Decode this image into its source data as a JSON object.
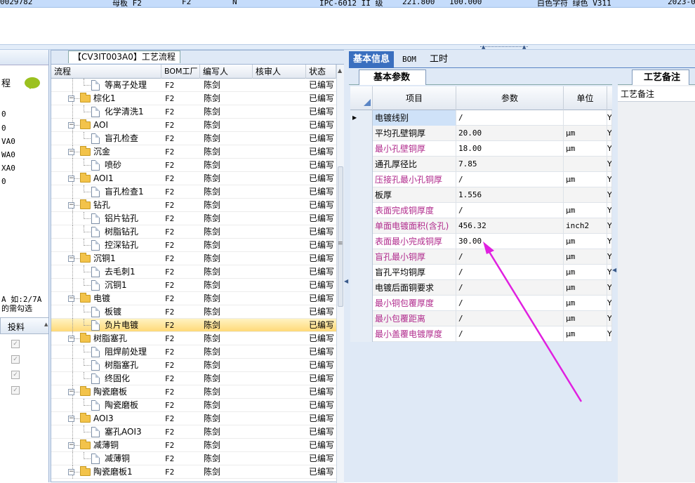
{
  "top_strip": {
    "cells": [
      "0029782",
      "母板 F2",
      "F2",
      "N",
      "IPC-6012 II 级",
      "221.800",
      "100.000",
      "白色字符 绿色 V311",
      "2023-0"
    ]
  },
  "left_panel": {
    "header": "程",
    "rows": [
      "0",
      "0",
      "VA0",
      "WA0",
      "XA0",
      "0"
    ],
    "note_line1": "A 如:2/7A",
    "note_line2": "的需勾选",
    "column_header": "投料",
    "checkboxes": [
      true,
      true,
      true,
      true
    ]
  },
  "process_panel": {
    "title": "【CV3IT003A0】工艺流程",
    "columns": [
      "流程",
      "BOM工厂",
      "编写人",
      "核审人",
      "状态"
    ],
    "rows": [
      {
        "level": 2,
        "type": "doc",
        "name": "等离子处理",
        "bom": "F2",
        "writer": "陈剑",
        "reviewer": "",
        "status": "已编写"
      },
      {
        "level": 1,
        "type": "folder",
        "name": "棕化1",
        "bom": "F2",
        "writer": "陈剑",
        "reviewer": "",
        "status": "已编写"
      },
      {
        "level": 2,
        "type": "doc",
        "name": "化学清洗1",
        "bom": "F2",
        "writer": "陈剑",
        "reviewer": "",
        "status": "已编写"
      },
      {
        "level": 1,
        "type": "folder",
        "name": "AOI",
        "bom": "F2",
        "writer": "陈剑",
        "reviewer": "",
        "status": "已编写"
      },
      {
        "level": 2,
        "type": "doc",
        "name": "盲孔检查",
        "bom": "F2",
        "writer": "陈剑",
        "reviewer": "",
        "status": "已编写"
      },
      {
        "level": 1,
        "type": "folder",
        "name": "沉金",
        "bom": "F2",
        "writer": "陈剑",
        "reviewer": "",
        "status": "已编写"
      },
      {
        "level": 2,
        "type": "doc",
        "name": "喷砂",
        "bom": "F2",
        "writer": "陈剑",
        "reviewer": "",
        "status": "已编写"
      },
      {
        "level": 1,
        "type": "folder",
        "name": "AOI1",
        "bom": "F2",
        "writer": "陈剑",
        "reviewer": "",
        "status": "已编写"
      },
      {
        "level": 2,
        "type": "doc",
        "name": "盲孔检查1",
        "bom": "F2",
        "writer": "陈剑",
        "reviewer": "",
        "status": "已编写"
      },
      {
        "level": 1,
        "type": "folder",
        "name": "钻孔",
        "bom": "F2",
        "writer": "陈剑",
        "reviewer": "",
        "status": "已编写"
      },
      {
        "level": 2,
        "type": "doc",
        "name": "铝片钻孔",
        "bom": "F2",
        "writer": "陈剑",
        "reviewer": "",
        "status": "已编写"
      },
      {
        "level": 2,
        "type": "doc",
        "name": "树脂钻孔",
        "bom": "F2",
        "writer": "陈剑",
        "reviewer": "",
        "status": "已编写"
      },
      {
        "level": 2,
        "type": "doc",
        "name": "控深钻孔",
        "bom": "F2",
        "writer": "陈剑",
        "reviewer": "",
        "status": "已编写"
      },
      {
        "level": 1,
        "type": "folder",
        "name": "沉铜1",
        "bom": "F2",
        "writer": "陈剑",
        "reviewer": "",
        "status": "已编写"
      },
      {
        "level": 2,
        "type": "doc",
        "name": "去毛刺1",
        "bom": "F2",
        "writer": "陈剑",
        "reviewer": "",
        "status": "已编写"
      },
      {
        "level": 2,
        "type": "doc",
        "name": "沉铜1",
        "bom": "F2",
        "writer": "陈剑",
        "reviewer": "",
        "status": "已编写"
      },
      {
        "level": 1,
        "type": "folder",
        "name": "电镀",
        "bom": "F2",
        "writer": "陈剑",
        "reviewer": "",
        "status": "已编写"
      },
      {
        "level": 2,
        "type": "doc",
        "name": "板镀",
        "bom": "F2",
        "writer": "陈剑",
        "reviewer": "",
        "status": "已编写"
      },
      {
        "level": 2,
        "type": "doc",
        "name": "负片电镀",
        "bom": "F2",
        "writer": "陈剑",
        "reviewer": "",
        "status": "已编写",
        "selected": true
      },
      {
        "level": 1,
        "type": "folder",
        "name": "树脂塞孔",
        "bom": "F2",
        "writer": "陈剑",
        "reviewer": "",
        "status": "已编写"
      },
      {
        "level": 2,
        "type": "doc",
        "name": "阻焊前处理",
        "bom": "F2",
        "writer": "陈剑",
        "reviewer": "",
        "status": "已编写"
      },
      {
        "level": 2,
        "type": "doc",
        "name": "树脂塞孔",
        "bom": "F2",
        "writer": "陈剑",
        "reviewer": "",
        "status": "已编写"
      },
      {
        "level": 2,
        "type": "doc",
        "name": "终固化",
        "bom": "F2",
        "writer": "陈剑",
        "reviewer": "",
        "status": "已编写"
      },
      {
        "level": 1,
        "type": "folder",
        "name": "陶瓷磨板",
        "bom": "F2",
        "writer": "陈剑",
        "reviewer": "",
        "status": "已编写"
      },
      {
        "level": 2,
        "type": "doc",
        "name": "陶瓷磨板",
        "bom": "F2",
        "writer": "陈剑",
        "reviewer": "",
        "status": "已编写"
      },
      {
        "level": 1,
        "type": "folder",
        "name": "AOI3",
        "bom": "F2",
        "writer": "陈剑",
        "reviewer": "",
        "status": "已编写"
      },
      {
        "level": 2,
        "type": "doc",
        "name": "塞孔AOI3",
        "bom": "F2",
        "writer": "陈剑",
        "reviewer": "",
        "status": "已编写"
      },
      {
        "level": 1,
        "type": "folder",
        "name": "减薄铜",
        "bom": "F2",
        "writer": "陈剑",
        "reviewer": "",
        "status": "已编写"
      },
      {
        "level": 2,
        "type": "doc",
        "name": "减薄铜",
        "bom": "F2",
        "writer": "陈剑",
        "reviewer": "",
        "status": "已编写"
      },
      {
        "level": 1,
        "type": "folder",
        "name": "陶瓷磨板1",
        "bom": "F2",
        "writer": "陈剑",
        "reviewer": "",
        "status": "已编写"
      }
    ]
  },
  "right_tabs": [
    "基本信息",
    "BOM",
    "工时"
  ],
  "params_panel": {
    "subtab": "基本参数",
    "columns": [
      "项目",
      "参数",
      "单位"
    ],
    "rows": [
      {
        "item": "电镀线别",
        "value": "/",
        "unit": "",
        "flag": "Y",
        "pink": false,
        "current": true
      },
      {
        "item": "平均孔壁铜厚",
        "value": "20.00",
        "unit": "μm",
        "flag": "Y",
        "pink": false
      },
      {
        "item": "最小孔壁铜厚",
        "value": "18.00",
        "unit": "μm",
        "flag": "Y",
        "pink": true
      },
      {
        "item": "通孔厚径比",
        "value": "7.85",
        "unit": "",
        "flag": "Y",
        "pink": false
      },
      {
        "item": "压接孔最小孔铜厚",
        "value": "/",
        "unit": "μm",
        "flag": "Y",
        "pink": true
      },
      {
        "item": "板厚",
        "value": "1.556",
        "unit": "",
        "flag": "Y",
        "pink": false
      },
      {
        "item": "表面完成铜厚度",
        "value": "/",
        "unit": "μm",
        "flag": "Y",
        "pink": true
      },
      {
        "item": "单面电镀面积(含孔)",
        "value": "456.32",
        "unit": "inch2",
        "flag": "Y",
        "pink": true
      },
      {
        "item": "表面最小完成铜厚",
        "value": "30.00",
        "unit": "μm",
        "flag": "Y",
        "pink": true
      },
      {
        "item": "盲孔最小铜厚",
        "value": "/",
        "unit": "μm",
        "flag": "Y",
        "pink": true
      },
      {
        "item": "盲孔平均铜厚",
        "value": "/",
        "unit": "μm",
        "flag": "Y",
        "pink": false
      },
      {
        "item": "电镀后面铜要求",
        "value": "/",
        "unit": "μm",
        "flag": "Y",
        "pink": false
      },
      {
        "item": "最小铜包覆厚度",
        "value": "/",
        "unit": "μm",
        "flag": "Y",
        "pink": true
      },
      {
        "item": "最小包覆距离",
        "value": "/",
        "unit": "μm",
        "flag": "Y",
        "pink": true
      },
      {
        "item": "最小盖覆电镀厚度",
        "value": "/",
        "unit": "μm",
        "flag": "Y",
        "pink": true
      }
    ]
  },
  "notes_panel": {
    "tab": "工艺备注",
    "label": "工艺备注"
  },
  "colors": {
    "pink_item": "#b02a8c",
    "arrow": "#e020e0",
    "selected_row": "#ffd978",
    "active_tab": "#3a6fbf"
  }
}
